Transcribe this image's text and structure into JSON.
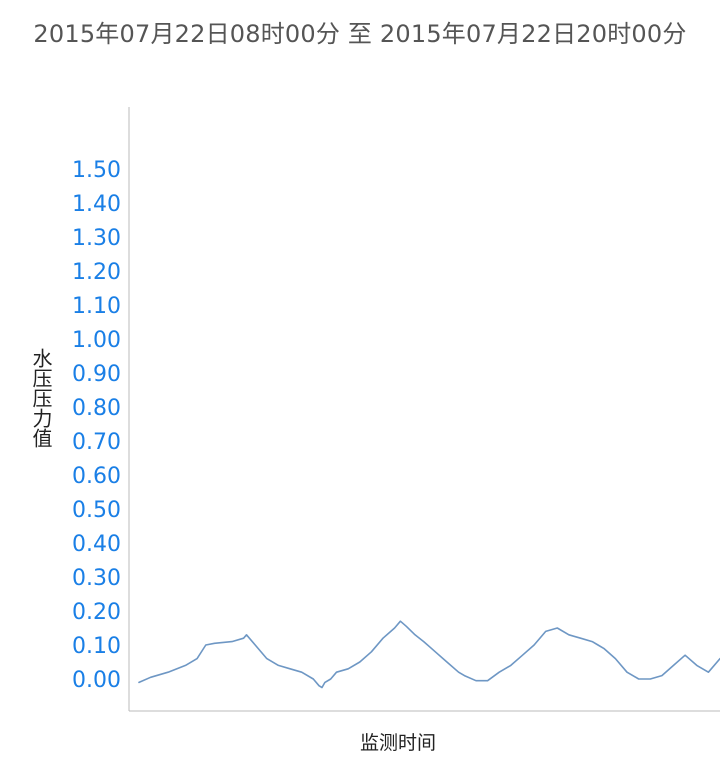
{
  "chart_data": {
    "type": "line",
    "title": "2015年07月22日08时00分 至 2015年07月22日20时00分",
    "xlabel": "监测时间",
    "ylabel": "水压压力值",
    "yticks": [
      "0.00",
      "0.10",
      "0.20",
      "0.30",
      "0.40",
      "0.50",
      "0.60",
      "0.70",
      "0.80",
      "0.90",
      "1.00",
      "1.10",
      "1.20",
      "1.30",
      "1.40",
      "1.50"
    ],
    "ylim": [
      -0.03,
      1.62
    ],
    "x_visible": false,
    "grid": false,
    "colors": {
      "line": "#6e97c4",
      "tick": "#1a7fe6",
      "axis": "#bbbbbb"
    },
    "series": [
      {
        "x": [
          0,
          0.02,
          0.05,
          0.08,
          0.1,
          0.115,
          0.13,
          0.16,
          0.18,
          0.185,
          0.2,
          0.22,
          0.24,
          0.26,
          0.28,
          0.3,
          0.31,
          0.315,
          0.32,
          0.33,
          0.34,
          0.36,
          0.38,
          0.4,
          0.42,
          0.44,
          0.45,
          0.46,
          0.475,
          0.49,
          0.5,
          0.51,
          0.53,
          0.55,
          0.56,
          0.58,
          0.6,
          0.62,
          0.64,
          0.66,
          0.68,
          0.7,
          0.72,
          0.74,
          0.76,
          0.78,
          0.79,
          0.8,
          0.82,
          0.84,
          0.86,
          0.88,
          0.9,
          0.92,
          0.94,
          0.96,
          0.98,
          1.0
        ],
        "values": [
          -0.01,
          0.005,
          0.02,
          0.04,
          0.06,
          0.1,
          0.105,
          0.11,
          0.12,
          0.13,
          0.1,
          0.06,
          0.04,
          0.03,
          0.02,
          0.0,
          -0.02,
          -0.025,
          -0.01,
          0.0,
          0.02,
          0.03,
          0.05,
          0.08,
          0.12,
          0.15,
          0.17,
          0.155,
          0.13,
          0.11,
          0.095,
          0.08,
          0.05,
          0.02,
          0.01,
          -0.005,
          -0.005,
          0.02,
          0.04,
          0.07,
          0.1,
          0.14,
          0.15,
          0.13,
          0.12,
          0.11,
          0.1,
          0.09,
          0.06,
          0.02,
          0.0,
          0.0,
          0.01,
          0.04,
          0.07,
          0.04,
          0.02,
          0.06
        ]
      }
    ]
  }
}
